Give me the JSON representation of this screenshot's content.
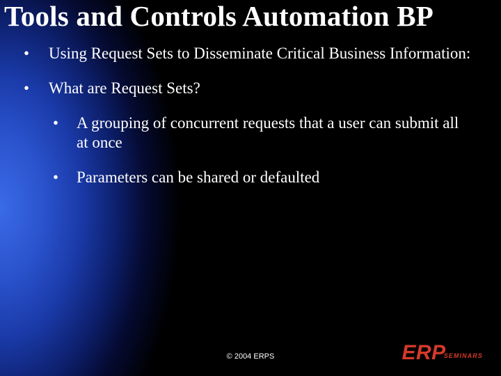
{
  "title": "Tools and Controls Automation BP",
  "bullets": [
    {
      "text": "Using Request Sets to Disseminate Critical Business Information:"
    },
    {
      "text": "What are Request Sets?",
      "children": [
        {
          "text": "A grouping of concurrent requests that a user can submit all at once"
        },
        {
          "text": "Parameters can be shared or defaulted"
        }
      ]
    }
  ],
  "footer": "© 2004 ERPS",
  "logo": {
    "main": "ERP",
    "sub": "SEMINARS"
  },
  "bullet_glyph": "•"
}
